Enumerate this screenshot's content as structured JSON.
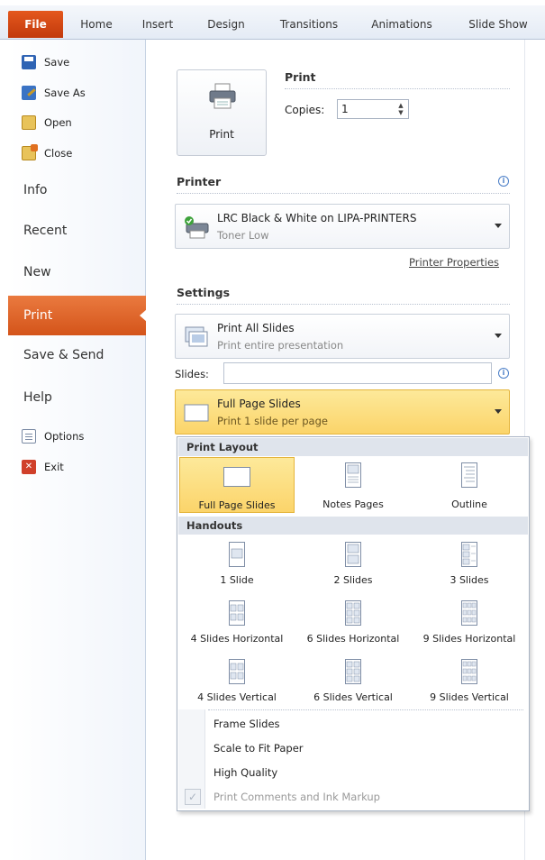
{
  "ribbon": {
    "tabs": [
      "File",
      "Home",
      "Insert",
      "Design",
      "Transitions",
      "Animations",
      "Slide Show"
    ]
  },
  "nav": {
    "save": "Save",
    "save_as": "Save As",
    "open": "Open",
    "close": "Close",
    "info": "Info",
    "recent": "Recent",
    "new": "New",
    "print": "Print",
    "save_send": "Save & Send",
    "help": "Help",
    "options": "Options",
    "exit": "Exit"
  },
  "print_section": {
    "title": "Print",
    "button_label": "Print",
    "copies_label": "Copies:",
    "copies_value": "1"
  },
  "printer": {
    "title": "Printer",
    "name": "LRC Black & White on LIPA-PRINTERS",
    "status": "Toner Low",
    "properties_link": "Printer Properties"
  },
  "settings": {
    "title": "Settings",
    "range": {
      "title": "Print All Slides",
      "subtitle": "Print entire presentation"
    },
    "slides_label": "Slides:",
    "slides_value": "",
    "layout": {
      "title": "Full Page Slides",
      "subtitle": "Print 1 slide per page"
    }
  },
  "layout_menu": {
    "print_layout_header": "Print Layout",
    "print_layout": [
      "Full Page Slides",
      "Notes Pages",
      "Outline"
    ],
    "selected": "Full Page Slides",
    "handouts_header": "Handouts",
    "handouts": [
      "1 Slide",
      "2 Slides",
      "3 Slides",
      "4 Slides Horizontal",
      "6 Slides Horizontal",
      "9 Slides Horizontal",
      "4 Slides Vertical",
      "6 Slides Vertical",
      "9 Slides Vertical"
    ],
    "options": {
      "frame_slides": "Frame Slides",
      "scale_to_fit": "Scale to Fit Paper",
      "high_quality": "High Quality",
      "print_comments": "Print Comments and Ink Markup"
    }
  },
  "colors": {
    "file_tab": "#d44b16",
    "selected_nav": "#e06a2c",
    "selected_item": "#fbd46a"
  }
}
